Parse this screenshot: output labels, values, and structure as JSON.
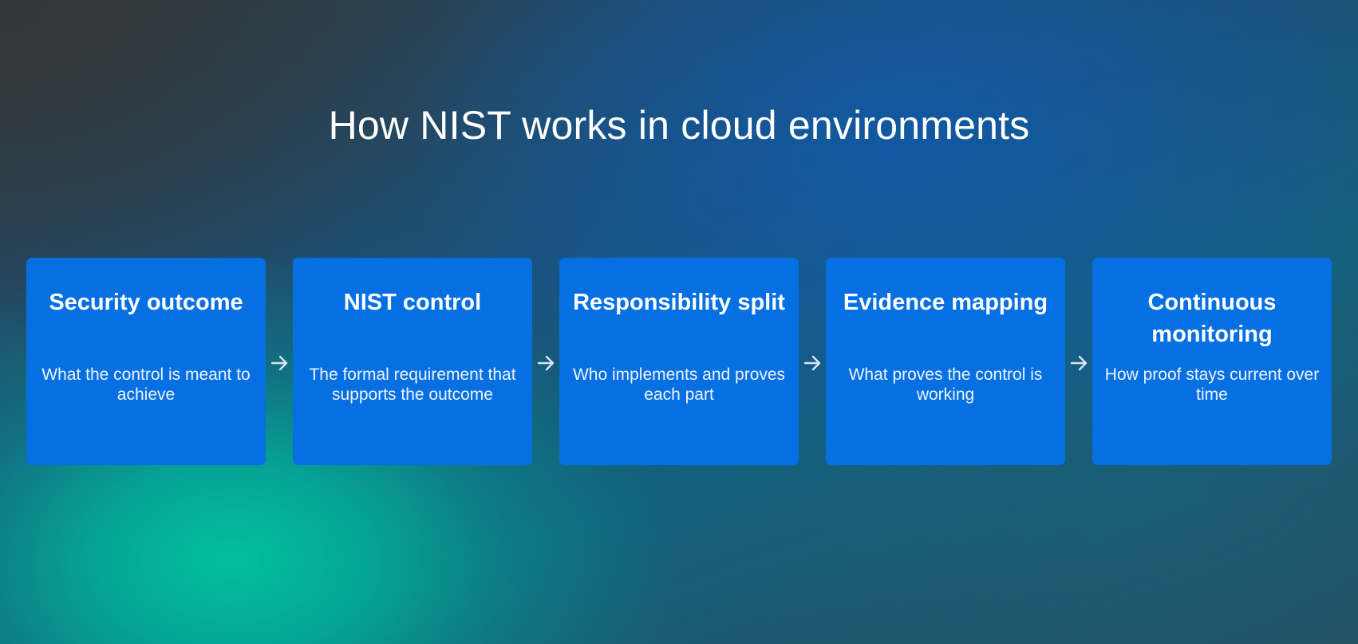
{
  "title": "How NIST works in cloud environments",
  "steps": [
    {
      "title": "Security outcome",
      "description": "What the control is meant to achieve"
    },
    {
      "title": "NIST control",
      "description": "The formal requirement that supports the outcome"
    },
    {
      "title": "Responsibility split",
      "description": "Who implements and proves each part"
    },
    {
      "title": "Evidence mapping",
      "description": "What proves the control is working"
    },
    {
      "title": "Continuous monitoring",
      "description": "How proof stays current over time"
    }
  ],
  "colors": {
    "card": "#0670e3",
    "text": "#ffffff",
    "arrow": "#d8e6ee"
  },
  "icons": {
    "connector": "arrow-right-icon"
  }
}
